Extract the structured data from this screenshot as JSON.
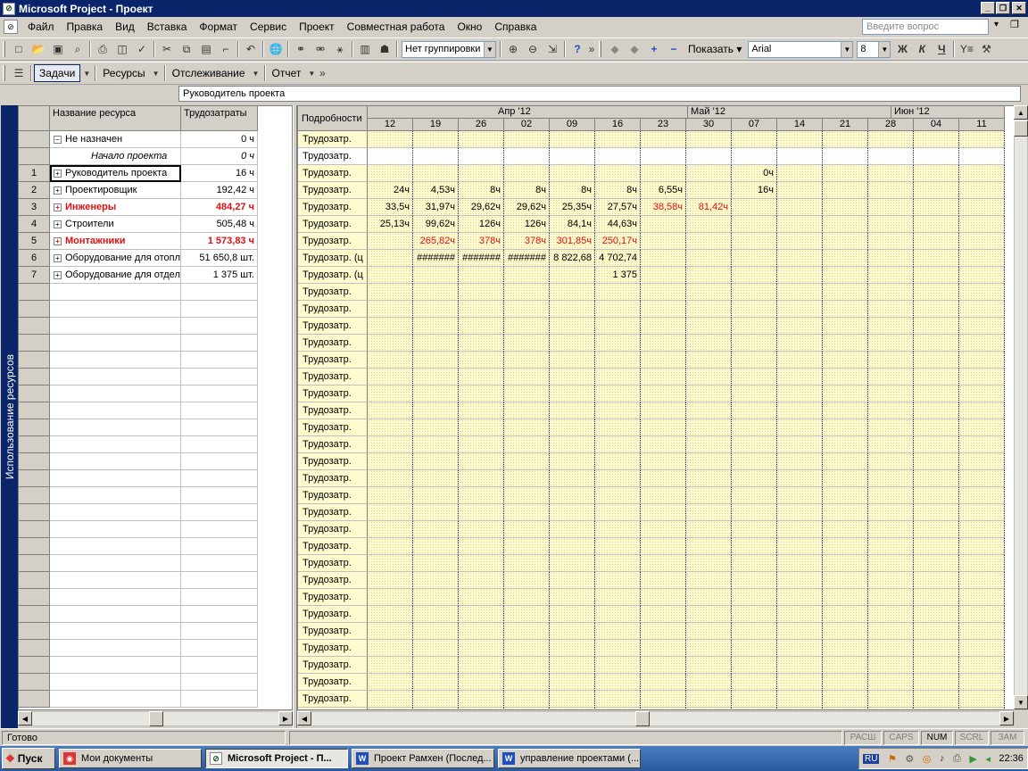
{
  "window": {
    "title": "Microsoft Project - Проект"
  },
  "menu": {
    "items": [
      "Файл",
      "Правка",
      "Вид",
      "Вставка",
      "Формат",
      "Сервис",
      "Проект",
      "Совместная работа",
      "Окно",
      "Справка"
    ],
    "ask_placeholder": "Введите вопрос"
  },
  "toolbar": {
    "grouping": "Нет группировки",
    "show_label": "Показать",
    "font": "Arial",
    "font_size": "8",
    "bold": "Ж",
    "italic": "К",
    "underline": "Ч"
  },
  "guide": {
    "tasks": "Задачи",
    "resources": "Ресурсы",
    "tracking": "Отслеживание",
    "report": "Отчет"
  },
  "entry_bar": {
    "value": "Руководитель проекта"
  },
  "view_bar": {
    "label": "Использование ресурсов"
  },
  "left_table": {
    "headers": {
      "name": "Название ресурса",
      "work": "Трудозатраты"
    },
    "rows": [
      {
        "id": "",
        "name": "Не назначен",
        "work": "0 ч",
        "expander": "−",
        "style": "normal"
      },
      {
        "id": "",
        "name": "Начало проекта",
        "work": "0 ч",
        "expander": "",
        "style": "italic"
      },
      {
        "id": "1",
        "name": "Руководитель проекта",
        "work": "16 ч",
        "expander": "+",
        "style": "selected"
      },
      {
        "id": "2",
        "name": "Проектировщик",
        "work": "192,42 ч",
        "expander": "+",
        "style": "normal"
      },
      {
        "id": "3",
        "name": "Инженеры",
        "work": "484,27 ч",
        "expander": "+",
        "style": "over"
      },
      {
        "id": "4",
        "name": "Строители",
        "work": "505,48 ч",
        "expander": "+",
        "style": "normal"
      },
      {
        "id": "5",
        "name": "Монтажники",
        "work": "1 573,83 ч",
        "expander": "+",
        "style": "over"
      },
      {
        "id": "6",
        "name": "Оборудование для отопл",
        "work": "51 650,8 шт.",
        "expander": "+",
        "style": "normal"
      },
      {
        "id": "7",
        "name": "Оборудование для отдел",
        "work": "1 375 шт.",
        "expander": "+",
        "style": "normal"
      }
    ]
  },
  "timescale": {
    "details_header": "Подробности",
    "months": [
      {
        "label": "Апр '12",
        "start": 3,
        "span": 7
      },
      {
        "label": "Май '12",
        "start": 7,
        "span": 4
      },
      {
        "label": "Июн '12",
        "start": 11,
        "span": 4
      }
    ],
    "weeks": [
      "12",
      "19",
      "26",
      "02",
      "09",
      "16",
      "23",
      "30",
      "07",
      "14",
      "21",
      "28",
      "04",
      "11"
    ]
  },
  "grid": {
    "detail_label": "Трудозатр.",
    "rows": [
      {
        "label": "Трудозатр.",
        "cells": [
          "",
          "",
          "",
          "",
          "",
          "",
          "",
          "",
          "",
          "",
          "",
          "",
          "",
          ""
        ],
        "red": []
      },
      {
        "label": "Трудозатр.",
        "cells": [
          "",
          "",
          "",
          "",
          "",
          "",
          "",
          "",
          "",
          "",
          "",
          "",
          "",
          ""
        ],
        "red": [],
        "white": true
      },
      {
        "label": "Трудозатр.",
        "cells": [
          "",
          "",
          "",
          "",
          "",
          "",
          "",
          "",
          "0ч",
          "",
          "",
          "",
          "",
          ""
        ],
        "red": []
      },
      {
        "label": "Трудозатр.",
        "cells": [
          "24ч",
          "4,53ч",
          "8ч",
          "8ч",
          "8ч",
          "8ч",
          "6,55ч",
          "",
          "16ч",
          "",
          "",
          "",
          "",
          ""
        ],
        "red": []
      },
      {
        "label": "Трудозатр.",
        "cells": [
          "33,5ч",
          "31,97ч",
          "29,62ч",
          "29,62ч",
          "25,35ч",
          "27,57ч",
          "38,58ч",
          "81,42ч",
          "",
          "",
          "",
          "",
          "",
          ""
        ],
        "red": [
          6,
          7
        ]
      },
      {
        "label": "Трудозатр.",
        "cells": [
          "25,13ч",
          "99,62ч",
          "126ч",
          "126ч",
          "84,1ч",
          "44,63ч",
          "",
          "",
          "",
          "",
          "",
          "",
          "",
          ""
        ],
        "red": []
      },
      {
        "label": "Трудозатр.",
        "cells": [
          "",
          "265,82ч",
          "378ч",
          "378ч",
          "301,85ч",
          "250,17ч",
          "",
          "",
          "",
          "",
          "",
          "",
          "",
          ""
        ],
        "red": [
          1,
          2,
          3,
          4,
          5
        ]
      },
      {
        "label": "Трудозатр. (ц",
        "cells": [
          "",
          "#######",
          "#######",
          "#######",
          "8 822,68",
          "4 702,74",
          "",
          "",
          "",
          "",
          "",
          "",
          "",
          ""
        ],
        "red": []
      },
      {
        "label": "Трудозатр. (ц",
        "cells": [
          "",
          "",
          "",
          "",
          "",
          "1 375",
          "",
          "",
          "",
          "",
          "",
          "",
          "",
          ""
        ],
        "red": []
      }
    ],
    "empty_rows": 26
  },
  "status": {
    "text": "Готово",
    "indicators": [
      "РАСШ",
      "CAPS",
      "NUM",
      "SCRL",
      "ЗАМ"
    ]
  },
  "taskbar": {
    "start": "Пуск",
    "tasks": [
      {
        "label": "Мои документы",
        "active": false
      },
      {
        "label": "Microsoft Project - П...",
        "active": true
      },
      {
        "label": "Проект Рамхен (Послед...",
        "active": false
      },
      {
        "label": "управление проектами (...",
        "active": false
      }
    ],
    "lang": "RU",
    "clock": "22:36"
  },
  "colors": {
    "titlebar": "#0a246a",
    "overallocated": "#e01010",
    "grid_bg": "#fffbcf"
  }
}
